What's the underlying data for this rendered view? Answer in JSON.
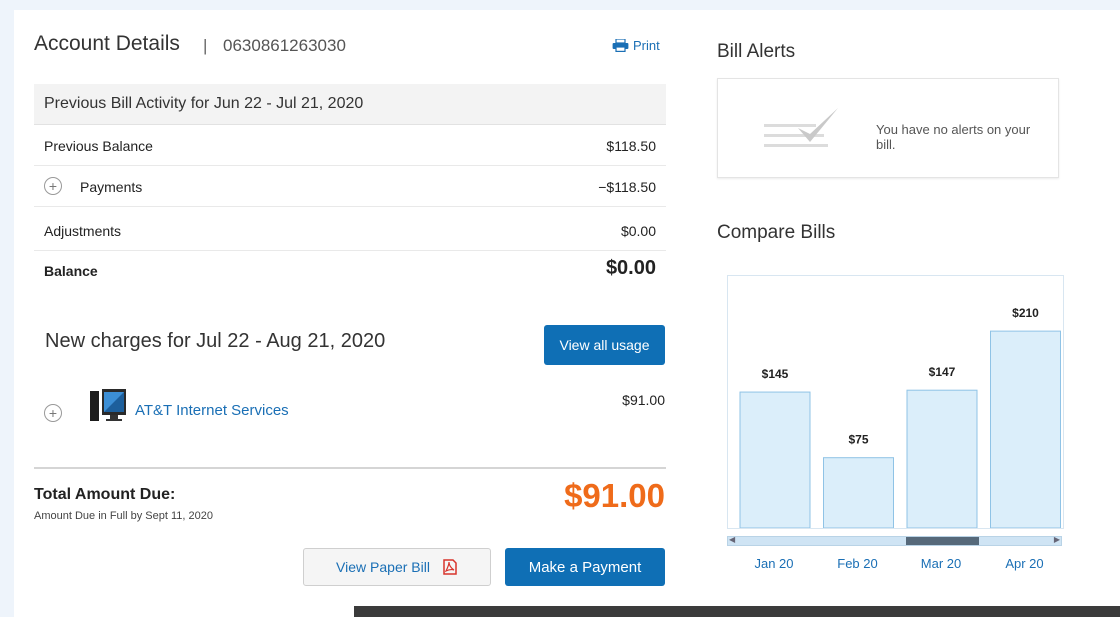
{
  "account": {
    "title": "Account Details",
    "separator": "|",
    "number": "0630861263030",
    "print_label": "Print"
  },
  "previous": {
    "header": "Previous Bill Activity for Jun 22 - Jul 21, 2020",
    "rows": [
      {
        "label": "Previous Balance",
        "value": "$118.50"
      },
      {
        "label": "Payments",
        "value": "−$118.50"
      },
      {
        "label": "Adjustments",
        "value": "$0.00"
      },
      {
        "label": "Balance",
        "value": "$0.00"
      }
    ]
  },
  "new_charges": {
    "title": "New charges for Jul 22 - Aug 21, 2020",
    "view_usage_label": "View all usage",
    "service_label": "AT&T Internet Services",
    "service_amount": "$91.00"
  },
  "total": {
    "label": "Total Amount Due:",
    "sub": "Amount Due in Full by Sept 11, 2020",
    "amount": "$91.00"
  },
  "actions": {
    "paper_bill_label": "View Paper Bill",
    "pay_label": "Make a Payment"
  },
  "alerts": {
    "title": "Bill Alerts",
    "message": "You have no alerts on your bill."
  },
  "compare": {
    "title": "Compare Bills"
  },
  "chart_data": {
    "type": "bar",
    "categories": [
      "Jan 20",
      "Feb 20",
      "Mar 20",
      "Apr 20"
    ],
    "values": [
      145,
      75,
      147,
      210
    ],
    "value_labels": [
      "$145",
      "$75",
      "$147",
      "$210"
    ],
    "ylim": [
      0,
      240
    ],
    "bar_color": "#dbeefa",
    "bar_border": "#8fc3e6",
    "label_color": "#1a6fb5"
  },
  "scrollbar": {
    "thumb_start_fraction": 0.53,
    "thumb_end_fraction": 0.75
  },
  "colors": {
    "accent": "#0f6fb5",
    "total_amount": "#ef6b1a",
    "link": "#1a6fb5"
  }
}
